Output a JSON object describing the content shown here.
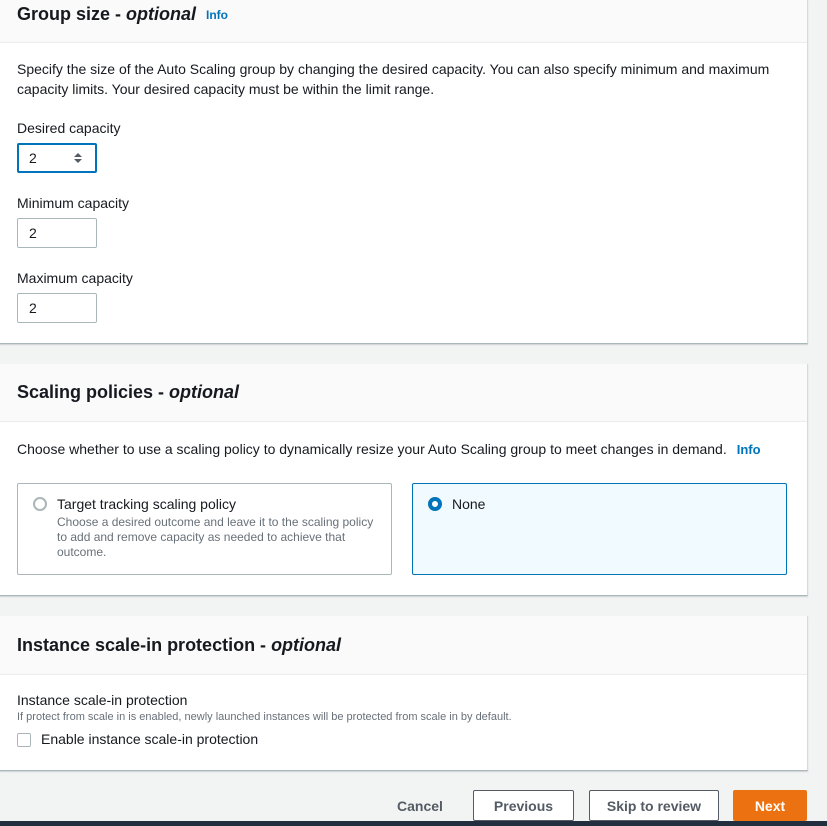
{
  "group_size": {
    "title": "Group size - ",
    "title_optional": "optional",
    "info": "Info",
    "description": "Specify the size of the Auto Scaling group by changing the desired capacity. You can also specify minimum and maximum capacity limits. Your desired capacity must be within the limit range.",
    "desired_label": "Desired capacity",
    "desired_value": "2",
    "min_label": "Minimum capacity",
    "min_value": "2",
    "max_label": "Maximum capacity",
    "max_value": "2"
  },
  "scaling_policies": {
    "title": "Scaling policies - ",
    "title_optional": "optional",
    "description": "Choose whether to use a scaling policy to dynamically resize your Auto Scaling group to meet changes in demand.",
    "info": "Info",
    "options": [
      {
        "label": "Target tracking scaling policy",
        "description": "Choose a desired outcome and leave it to the scaling policy to add and remove capacity as needed to achieve that outcome.",
        "selected": false
      },
      {
        "label": "None",
        "description": "",
        "selected": true
      }
    ]
  },
  "scale_in_protection": {
    "title": "Instance scale-in protection - ",
    "title_optional": "optional",
    "field_label": "Instance scale-in protection",
    "field_description": "If protect from scale in is enabled, newly launched instances will be protected from scale in by default.",
    "checkbox_label": "Enable instance scale-in protection",
    "checked": false
  },
  "footer": {
    "cancel": "Cancel",
    "previous": "Previous",
    "skip": "Skip to review",
    "next": "Next"
  },
  "colors": {
    "accent": "#0073bb",
    "primary_button": "#ec7211",
    "page_background": "#f2f3f3"
  }
}
